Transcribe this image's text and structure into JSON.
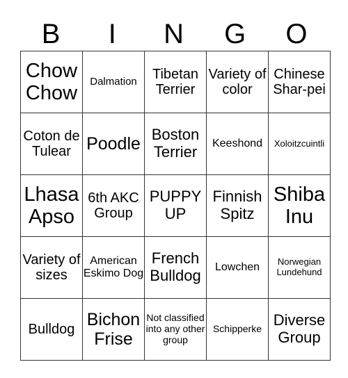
{
  "header": {
    "letters": [
      "B",
      "I",
      "N",
      "G",
      "O"
    ]
  },
  "board": {
    "rows": [
      [
        "Chow Chow",
        "Dalmation",
        "Tibetan Terrier",
        "Variety of color",
        "Chinese Shar-pei"
      ],
      [
        "Coton de Tulear",
        "Poodle",
        "Boston Terrier",
        "Keeshond",
        "Xoloitzcuintli"
      ],
      [
        "Lhasa Apso",
        "6th AKC Group",
        "PUPPY UP",
        "Finnish Spitz",
        "Shiba Inu"
      ],
      [
        "Variety of sizes",
        "American Eskimo Dog",
        "French Bulldog",
        "Lowchen",
        "Norwegian Lundehund"
      ],
      [
        "Bulldog",
        "Bichon Frise",
        "Not classified into any other group",
        "Schipperke",
        "Diverse Group"
      ]
    ]
  }
}
